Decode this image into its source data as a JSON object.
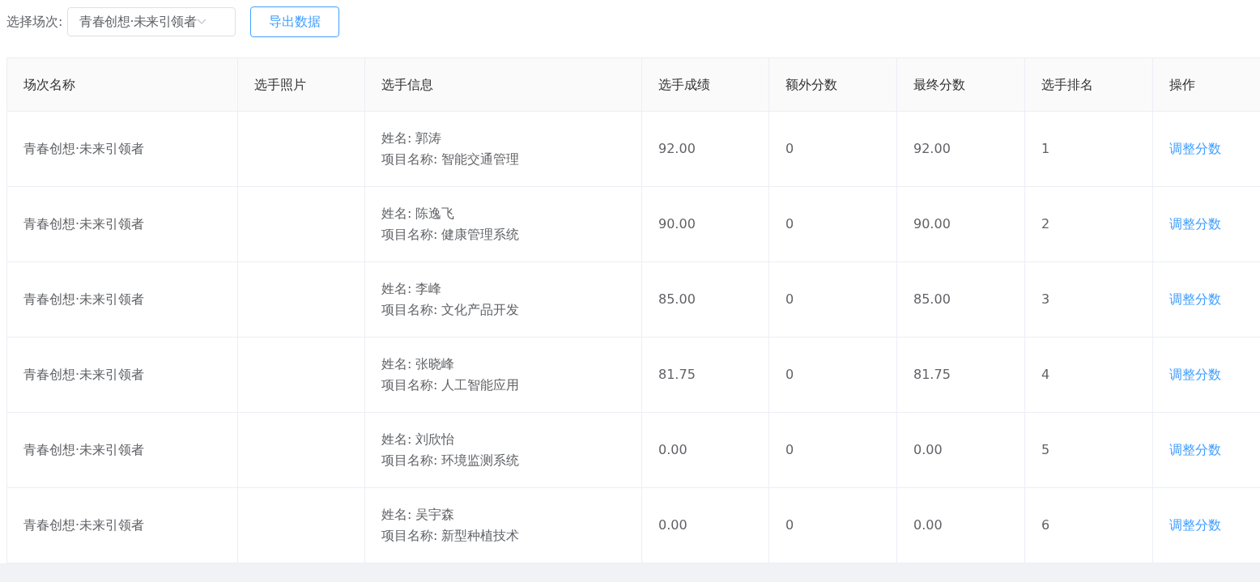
{
  "filter": {
    "label": "选择场次:",
    "value": "青春创想·未来引领者"
  },
  "export_button": "导出数据",
  "table": {
    "columns": [
      "场次名称",
      "选手照片",
      "选手信息",
      "选手成绩",
      "额外分数",
      "最终分数",
      "选手排名",
      "操作"
    ],
    "rows": [
      {
        "session": "青春创想·未来引领者",
        "name": "姓名: 郭涛",
        "project": "项目名称: 智能交通管理",
        "score": "92.00",
        "extra": "0",
        "final": "92.00",
        "rank": "1",
        "action": "调整分数"
      },
      {
        "session": "青春创想·未来引领者",
        "name": "姓名: 陈逸飞",
        "project": "项目名称: 健康管理系统",
        "score": "90.00",
        "extra": "0",
        "final": "90.00",
        "rank": "2",
        "action": "调整分数"
      },
      {
        "session": "青春创想·未来引领者",
        "name": "姓名: 李峰",
        "project": "项目名称: 文化产品开发",
        "score": "85.00",
        "extra": "0",
        "final": "85.00",
        "rank": "3",
        "action": "调整分数"
      },
      {
        "session": "青春创想·未来引领者",
        "name": "姓名: 张晓峰",
        "project": "项目名称: 人工智能应用",
        "score": "81.75",
        "extra": "0",
        "final": "81.75",
        "rank": "4",
        "action": "调整分数"
      },
      {
        "session": "青春创想·未来引领者",
        "name": "姓名: 刘欣怡",
        "project": "项目名称: 环境监测系统",
        "score": "0.00",
        "extra": "0",
        "final": "0.00",
        "rank": "5",
        "action": "调整分数"
      },
      {
        "session": "青春创想·未来引领者",
        "name": "姓名: 吴宇森",
        "project": "项目名称: 新型种植技术",
        "score": "0.00",
        "extra": "0",
        "final": "0.00",
        "rank": "6",
        "action": "调整分数"
      }
    ]
  }
}
